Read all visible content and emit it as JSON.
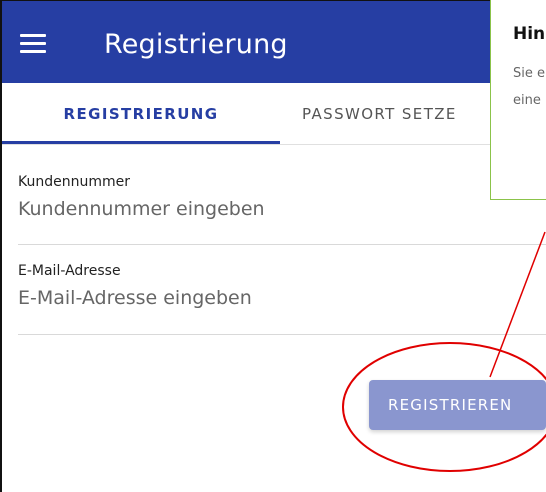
{
  "appbar": {
    "title": "Registrierung"
  },
  "tabs": [
    {
      "label": "REGISTRIERUNG",
      "active": true
    },
    {
      "label": "PASSWORT SETZE",
      "active": false
    }
  ],
  "form": {
    "customer_number": {
      "label": "Kundennummer",
      "placeholder": "Kundennummer eingeben",
      "value": ""
    },
    "email": {
      "label": "E-Mail-Adresse",
      "placeholder": "E-Mail-Adresse eingeben",
      "value": ""
    },
    "submit_label": "REGISTRIEREN"
  },
  "tooltip": {
    "title": "Hin",
    "lines": [
      "Sie e",
      "eine"
    ]
  },
  "colors": {
    "primary": "#263ea3",
    "button_disabled": "#8a96cf",
    "annotation": "#e00000",
    "tooltip_border": "#8bc34a"
  },
  "icons": {
    "menu": "hamburger-menu-icon"
  }
}
